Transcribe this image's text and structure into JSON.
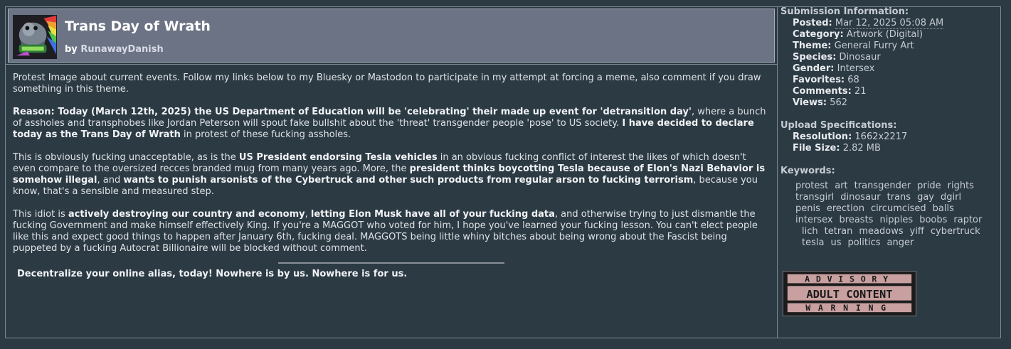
{
  "submission": {
    "title": "Trans Day of Wrath",
    "by_prefix": "by",
    "author": "RunawayDanish"
  },
  "description": {
    "p1": "Protest Image about current events. Follow my links below to my Bluesky or Mastodon to participate in my attempt at forcing a meme, also comment if you draw something in this theme.",
    "p2_bold1": "Reason: Today (March 12th, 2025) the US Department of Education will be 'celebrating' their made up event for 'detransition day'",
    "p2_text1": ", where a bunch of assholes and transphobes like Jordan Peterson will spout fake bullshit about the 'threat' transgender people 'pose' to US society. ",
    "p2_bold2": "I have decided to declare today as the Trans Day of Wrath",
    "p2_text2": " in protest of these fucking assholes.",
    "p3_text1": "This is obviously fucking unacceptable, as is the ",
    "p3_bold1": "US President endorsing Tesla vehicles",
    "p3_text2": " in an obvious fucking conflict of interest the likes of which doesn't even compare to the oversized recces branded mug from many years ago. More, the ",
    "p3_bold2": "president thinks boycotting Tesla because of Elon's Nazi Behavior is somehow illegal",
    "p3_text3": ", and ",
    "p3_bold3": "wants to punish arsonists of the Cybertruck and other such products from regular arson to fucking terrorism",
    "p3_text4": ", because you know, that's a sensible and measured step.",
    "p4_text1": "This idiot is ",
    "p4_bold1": "actively destroying our country and economy",
    "p4_text2": ", ",
    "p4_bold2": "letting Elon Musk have all of your fucking data",
    "p4_text3": ", and otherwise trying to just dismantle the fucking Government and make himself effectively King. If you're a MAGGOT who voted for him, I hope you've learned your fucking lesson. You can't elect people like this and expect good things to happen after January 6th, fucking deal. MAGGOTS being little whiny bitches about being wrong about the Fascist being puppeted by a fucking Autocrat Billionaire will be blocked without comment.",
    "tagline": "Decentralize your online alias, today! Nowhere is by us. Nowhere is for us."
  },
  "info": {
    "heading": "Submission Information:",
    "posted_label": "Posted:",
    "posted_value": "Mar 12, 2025 05:08 AM",
    "category_label": "Category:",
    "category_value": "Artwork (Digital)",
    "theme_label": "Theme:",
    "theme_value": "General Furry Art",
    "species_label": "Species:",
    "species_value": "Dinosaur",
    "gender_label": "Gender:",
    "gender_value": "Intersex",
    "favorites_label": "Favorites:",
    "favorites_value": "68",
    "comments_label": "Comments:",
    "comments_value": "21",
    "views_label": "Views:",
    "views_value": "562"
  },
  "specs": {
    "heading": "Upload Specifications:",
    "resolution_label": "Resolution:",
    "resolution_value": "1662x2217",
    "filesize_label": "File Size:",
    "filesize_value": "2.82 MB"
  },
  "keywords": {
    "heading": "Keywords:",
    "lines": [
      [
        "protest",
        "art",
        "transgender",
        "pride",
        "rights"
      ],
      [
        "transgirl",
        "dinosaur",
        "trans",
        "gay",
        "dgirl"
      ],
      [
        "penis",
        "erection",
        "circumcised",
        "balls"
      ],
      [
        "intersex",
        "breasts",
        "nipples",
        "boobs",
        "raptor"
      ],
      [
        "lich",
        "tetran",
        "meadows",
        "yiff",
        "cybertruck"
      ],
      [
        "tesla",
        "us",
        "politics",
        "anger"
      ]
    ]
  },
  "badge": {
    "top": "ADVISORY",
    "middle": "ADULT CONTENT",
    "bottom": "WARNING"
  },
  "colors": {
    "page_bg": "#2c3a44",
    "header_bg": "#6c7385",
    "badge_pink": "#c9a0a0"
  }
}
